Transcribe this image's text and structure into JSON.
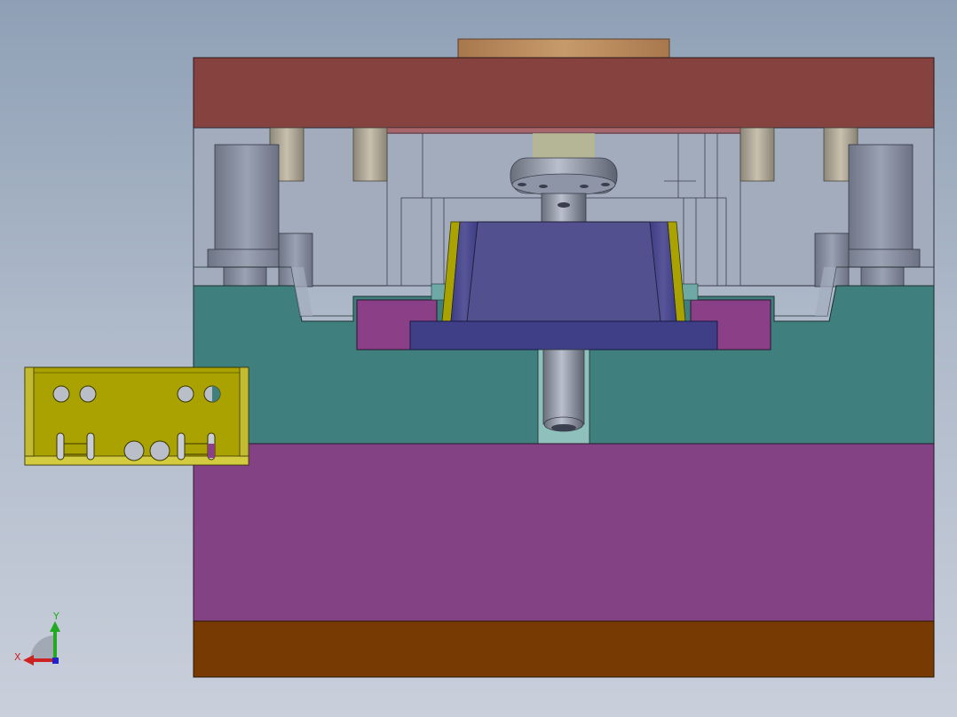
{
  "viewport": {
    "background_top": "#8fa0b6",
    "background_bottom": "#c9cfdb"
  },
  "model": {
    "parts": {
      "top_clamp_plate": "#86423f",
      "locating_ring": "#b9865a",
      "cavity_plate": "#3f7f7e",
      "ejector_box": "#824283",
      "bottom_clamp_plate": "#773a03",
      "core_insert": "#52508f",
      "support_plate": "#3f3f88",
      "slide_block": "#8a3f86",
      "molded_part": "#a9a200"
    }
  },
  "triad": {
    "x_label": "X",
    "y_label": "Y",
    "x_color": "#cc2222",
    "y_color": "#22aa22",
    "z_color": "#2222cc"
  }
}
